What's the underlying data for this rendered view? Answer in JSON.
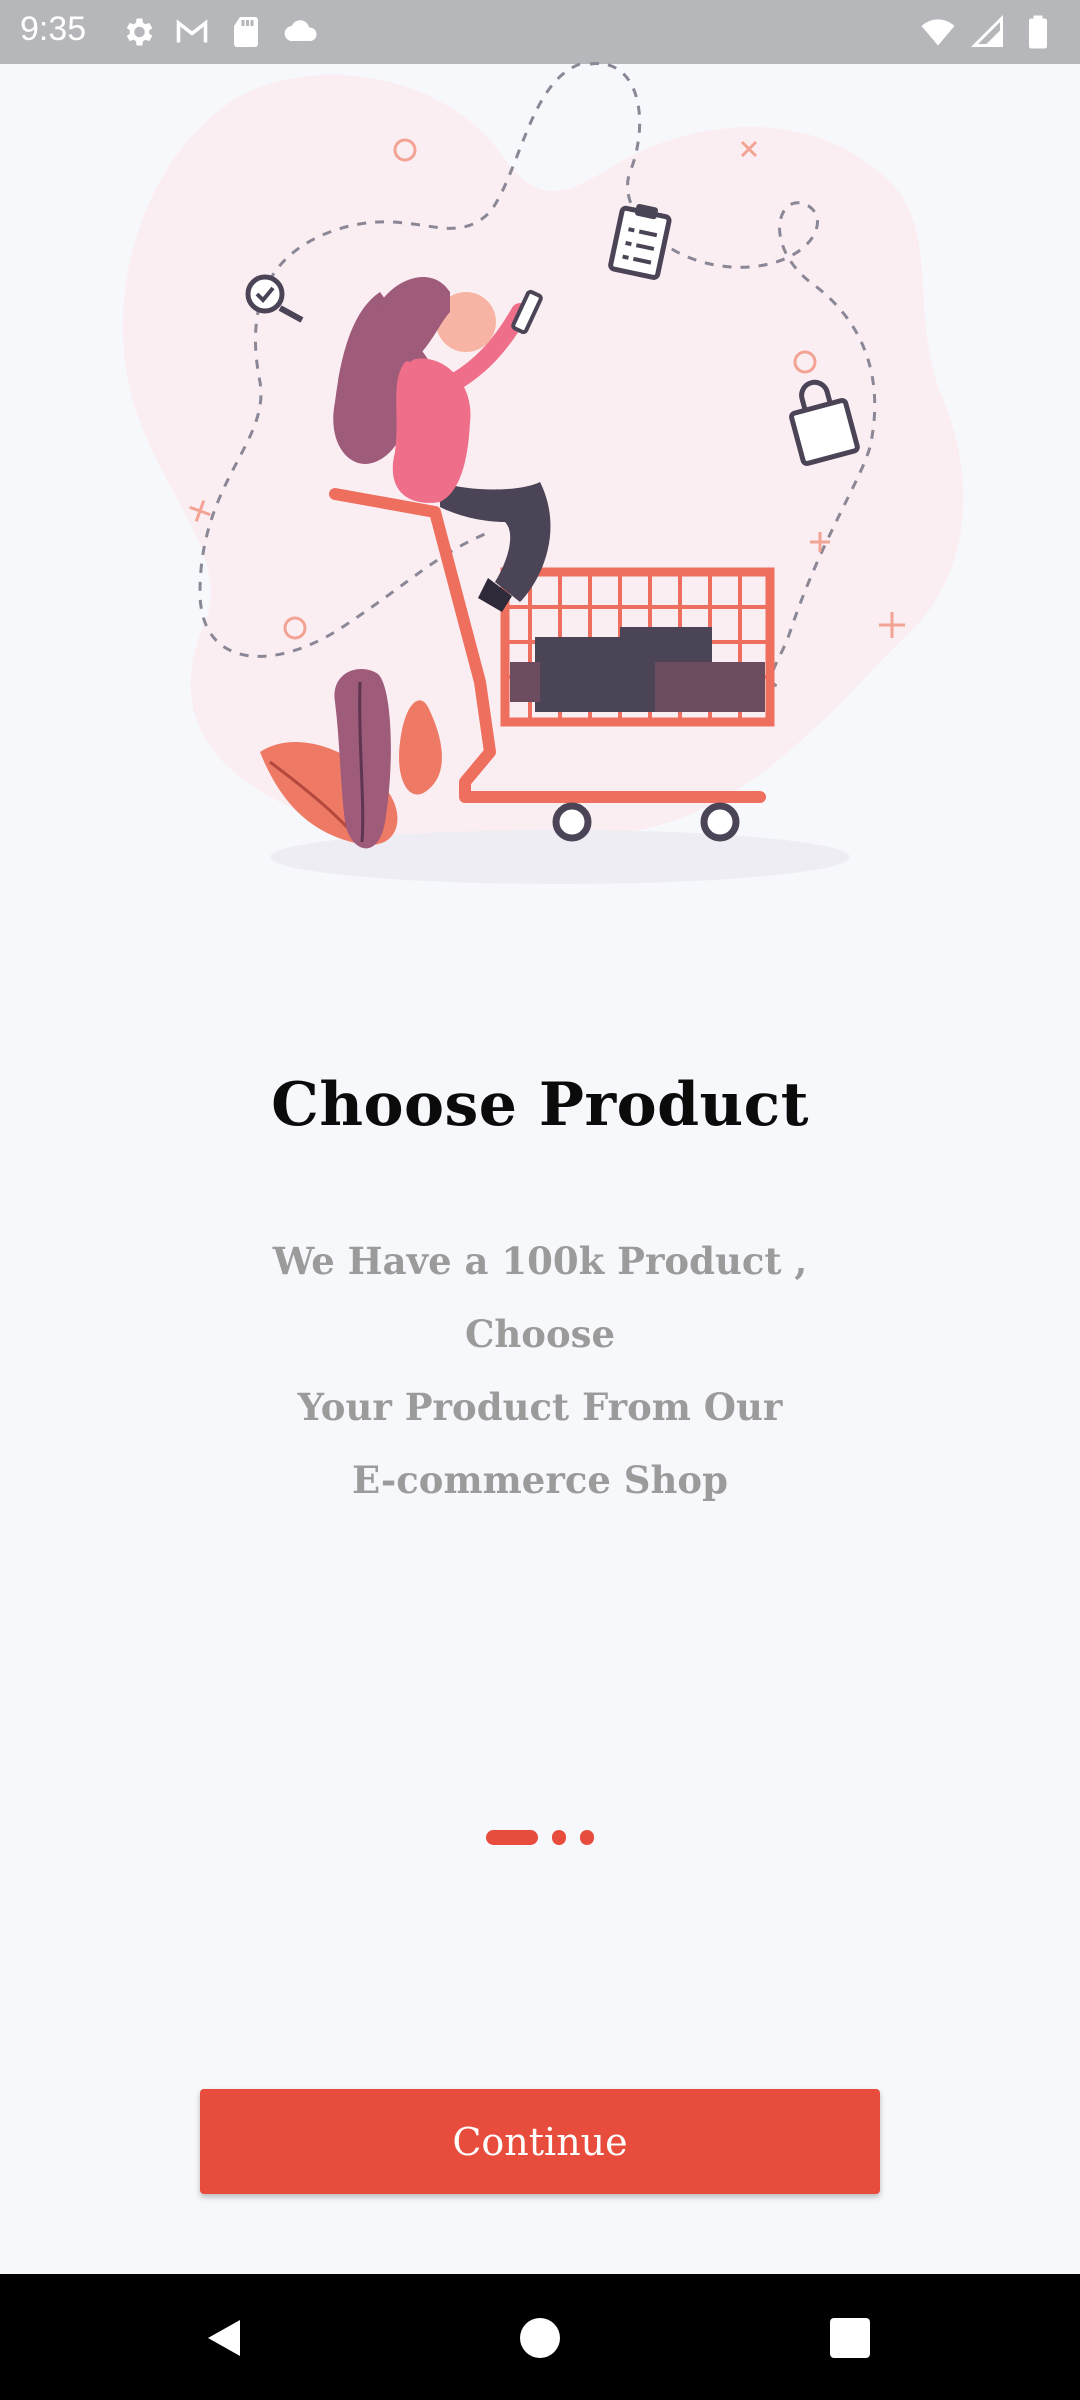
{
  "status_bar": {
    "time": "9:35",
    "left_icons": [
      "settings-icon",
      "gmail-icon",
      "sd-card-icon",
      "cloud-icon"
    ],
    "right_icons": [
      "wifi-icon",
      "cell-signal-icon",
      "battery-icon"
    ]
  },
  "onboarding": {
    "title": "Choose Product",
    "description_lines": [
      "We Have a 100k Product , Choose",
      "Your Product From  Our",
      "E-commerce Shop"
    ],
    "pager": {
      "total": 3,
      "active_index": 0
    },
    "continue_label": "Continue"
  },
  "colors": {
    "accent": "#e84c3d",
    "background": "#f7f8fc",
    "title": "#0b0b0b",
    "description": "#9b9b9b",
    "status_bar": "#b6b7bb"
  },
  "nav_bar": {
    "icons": [
      "back-icon",
      "home-icon",
      "recents-icon"
    ]
  }
}
